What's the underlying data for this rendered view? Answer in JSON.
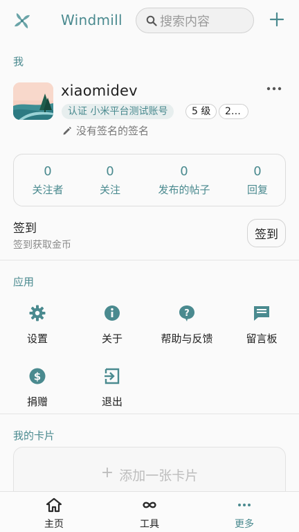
{
  "header": {
    "app_title": "Windmill",
    "search_placeholder": "搜索内容",
    "logo_icon": "windmill-icon",
    "add_icon": "plus-icon"
  },
  "me_section": {
    "label": "我",
    "username": "xiaomidev",
    "verify_chip": "认证 小米平台测试账号",
    "level_chip": "5 级",
    "count_chip": "2…",
    "signature": "没有签名的签名",
    "stats": [
      {
        "num": "0",
        "label": "关注者"
      },
      {
        "num": "0",
        "label": "关注"
      },
      {
        "num": "0",
        "label": "发布的帖子"
      },
      {
        "num": "0",
        "label": "回复"
      }
    ],
    "signin_title": "签到",
    "signin_sub": "签到获取金币",
    "signin_button": "签到"
  },
  "apps_section": {
    "label": "应用",
    "items": [
      {
        "label": "设置",
        "icon": "gear-icon"
      },
      {
        "label": "关于",
        "icon": "info-icon"
      },
      {
        "label": "帮助与反馈",
        "icon": "help-icon"
      },
      {
        "label": "留言板",
        "icon": "message-board-icon"
      },
      {
        "label": "捐赠",
        "icon": "dollar-icon"
      },
      {
        "label": "退出",
        "icon": "logout-icon"
      }
    ]
  },
  "cards_section": {
    "label": "我的卡片",
    "add_card": "添加一张卡片"
  },
  "bottom_nav": {
    "items": [
      {
        "label": "主页",
        "icon": "home-icon"
      },
      {
        "label": "工具",
        "icon": "infinity-icon"
      },
      {
        "label": "更多",
        "icon": "more-dots-icon"
      }
    ],
    "active": "更多"
  },
  "colors": {
    "accent": "#4a8a8f",
    "background": "#fafafa",
    "text": "#1f1f1f",
    "muted": "#8a8a8a"
  }
}
